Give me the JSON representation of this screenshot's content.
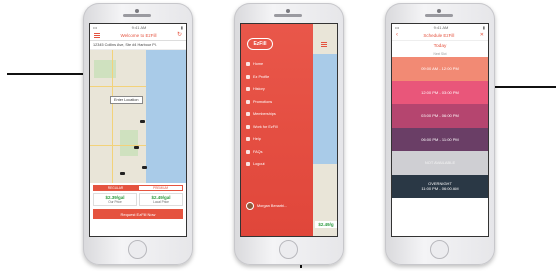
{
  "colors": {
    "accent": "#e5533f",
    "price_green": "#2e9b3f"
  },
  "phone1": {
    "status_time": "9:41 AM",
    "title": "Welcome to EzFill",
    "menu_icon": "hamburger-icon",
    "refresh_icon": "refresh-icon",
    "address": "12345 Collins Ave, Ste #4 Harbour Pl.",
    "enter_location": "Enter Location",
    "fuel_regular": "REGULAR",
    "fuel_premium": "PREMIUM",
    "our_price_value": "$2.39/gal",
    "our_price_label": "Our Price",
    "local_price_value": "$2.49/gal",
    "local_price_label": "Local Price",
    "request_button": "Request EzFill Now"
  },
  "phone2": {
    "logo": "EzFill",
    "menu_items": [
      {
        "label": "Home",
        "icon": "home-icon"
      },
      {
        "label": "Ez Profile",
        "icon": "profile-icon"
      },
      {
        "label": "History",
        "icon": "history-icon"
      },
      {
        "label": "Promotions",
        "icon": "promotions-icon"
      },
      {
        "label": "Memberships",
        "icon": "memberships-icon"
      },
      {
        "label": "Work for EzFill",
        "icon": "work-icon"
      },
      {
        "label": "Help",
        "icon": "help-icon"
      },
      {
        "label": "FAQs",
        "icon": "faq-icon"
      },
      {
        "label": "Logout",
        "icon": "logout-icon"
      }
    ],
    "user_name": "Morgan Benarbi...",
    "peek_price": "$2.49/g"
  },
  "phone3": {
    "title": "Schedule EzFill",
    "day": "Today",
    "next_slot_note": "Next Slot",
    "slots": [
      {
        "label": "09:00 AM - 12:00 PM",
        "color": "#f28a74"
      },
      {
        "label": "12:00 PM - 03:00 PM",
        "color": "#e9567a"
      },
      {
        "label": "03:00 PM - 06:00 PM",
        "color": "#b5456f"
      },
      {
        "label": "06:00 PM - 11:00 PM",
        "color": "#6a3e66"
      },
      {
        "label": "NOT AVAILABLE",
        "color": "#cfcfd3"
      }
    ],
    "overnight_title": "OVERNIGHT",
    "overnight_time": "11:00 PM - 06:00 AM",
    "overnight_color": "#2a3845"
  }
}
